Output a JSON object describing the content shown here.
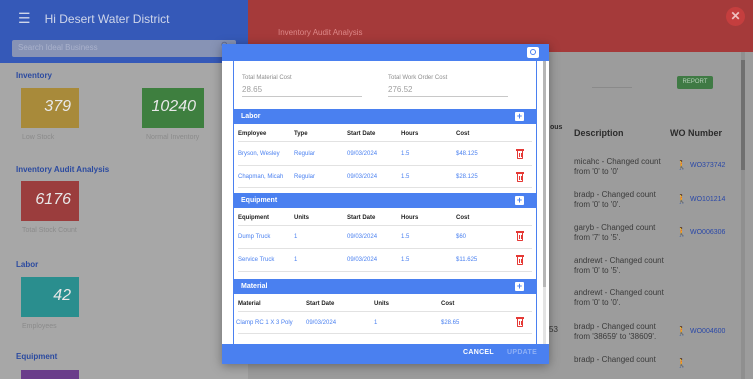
{
  "sidebar": {
    "title": "Hi Desert Water District",
    "search_placeholder": "Search Ideal Business",
    "sections": {
      "inventory": "Inventory",
      "audit": "Inventory Audit Analysis",
      "labor": "Labor",
      "equipment": "Equipment"
    },
    "tiles": [
      {
        "value": "379",
        "caption": "Low Stock",
        "color": "#a88a3a"
      },
      {
        "value": "10240",
        "caption": "Normal Inventory",
        "color": "#3e7f3f"
      },
      {
        "value": "6176",
        "caption": "Total Stock Count",
        "color": "#9b3d3d"
      },
      {
        "value": "42",
        "caption": "Employees",
        "color": "#2a8e8e"
      }
    ]
  },
  "main": {
    "header_title": "Inventory Audit Analysis",
    "report_button": "REPORT",
    "columns": {
      "previous": "Previous\nous",
      "description": "Description",
      "wo_number": "WO Number"
    },
    "rows": [
      {
        "description": "micahc - Changed count from '0' to '0'",
        "wo": "WO373742"
      },
      {
        "description": "bradp - Changed count from '0' to '0'.",
        "wo": "WO101214"
      },
      {
        "description": "garyb - Changed count from '7' to '5'.",
        "wo": "WO006306"
      },
      {
        "description": "andrewt - Changed count from '0' to '5'.",
        "wo": ""
      },
      {
        "description": "andrewt - Changed count from '0' to '0'.",
        "wo": ""
      },
      {
        "description": "bradp - Changed count from '38659' to '38609'.",
        "wo": "WO004600"
      },
      {
        "description": "bradp - Changed count",
        "wo": ""
      }
    ],
    "partial_number": "53"
  },
  "modal": {
    "total_material_cost_label": "Total Material Cost",
    "total_material_cost": "28.65",
    "total_work_order_cost_label": "Total Work Order Cost",
    "total_work_order_cost": "276.52",
    "labor": {
      "title": "Labor",
      "headers": [
        "Employee",
        "Type",
        "Start Date",
        "Hours",
        "Cost"
      ],
      "rows": [
        {
          "employee": "Bryson, Wesley",
          "type": "Regular",
          "start": "09/03/2024",
          "hours": "1.5",
          "cost": "$48.125"
        },
        {
          "employee": "Chapman, Micah",
          "type": "Regular",
          "start": "09/03/2024",
          "hours": "1.5",
          "cost": "$28.125"
        }
      ]
    },
    "equipment": {
      "title": "Equipment",
      "headers": [
        "Equipment",
        "Units",
        "Start Date",
        "Hours",
        "Cost"
      ],
      "rows": [
        {
          "equipment": "Dump Truck",
          "units": "1",
          "start": "09/03/2024",
          "hours": "1.5",
          "cost": "$60"
        },
        {
          "equipment": "Service Truck",
          "units": "1",
          "start": "09/03/2024",
          "hours": "1.5",
          "cost": "$11.625"
        }
      ]
    },
    "material": {
      "title": "Material",
      "headers": [
        "Material",
        "Start Date",
        "Units",
        "Cost"
      ],
      "rows": [
        {
          "material": "Clamp RC 1 X 3 Poly",
          "start": "09/03/2024",
          "units": "1",
          "cost": "$28.65"
        }
      ]
    },
    "cancel": "CANCEL",
    "update": "UPDATE"
  }
}
